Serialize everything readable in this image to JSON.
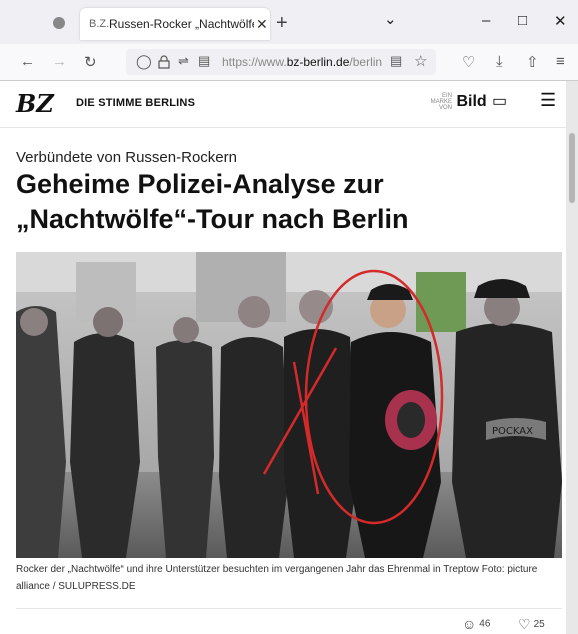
{
  "browser": {
    "tab_title": "Russen-Rocker „Nachtwölfe“ in",
    "tab_favicon": "B.Z.",
    "close_tab": "✕",
    "new_tab": "+",
    "url_prefix": "https://www.",
    "url_domain": "bz-berlin.de",
    "url_rest": "/berlin",
    "icons": [
      "back-arrow-icon",
      "forward-arrow-icon",
      "reload-icon",
      "shield-icon",
      "lock-icon",
      "permissions-icon",
      "reader-view-icon",
      "bookmark-star-icon",
      "pocket-icon",
      "download-icon",
      "extensions-icon",
      "app-menu-icon"
    ]
  },
  "site": {
    "logo": "BZ",
    "logo_sub": "DIE STIMME BERLINS",
    "bild_small": "EIN MARKE VON",
    "bild_logo": "Bild"
  },
  "article": {
    "kicker": "Verbündete von Russen-Rockern",
    "headline": "Geheime Polizei-Analyse zur „Nachtwölfe“-Tour nach Berlin",
    "caption": "Rocker der „Nachtwölfe“ und ihre Unterstützer besuchten im vergangenen Jahr das Ehrenmal in Treptow Foto: picture alliance / SULUPRESS.DE",
    "photo_patch": "POCKAX",
    "comments_count": "46",
    "likes_count": "25"
  },
  "colors": {
    "annotation_red": "#d42a2a",
    "patch_red": "#a8324d"
  }
}
